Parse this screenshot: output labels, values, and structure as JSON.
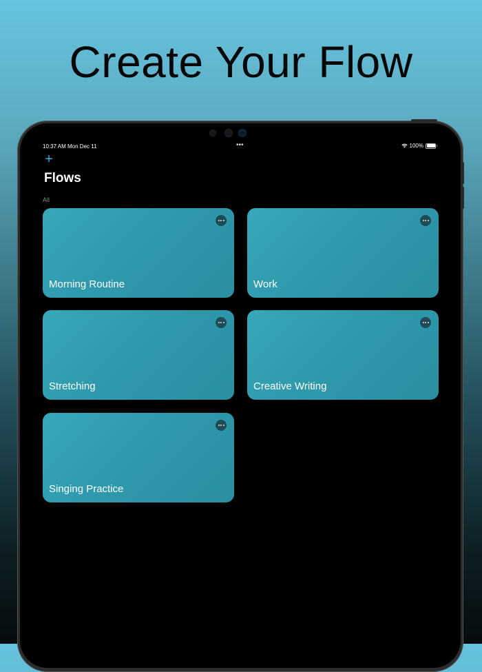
{
  "headline": "Create Your Flow",
  "status_bar": {
    "time": "10:37 AM",
    "date": "Mon Dec 11",
    "dots": "•••",
    "battery_text": "100%"
  },
  "nav": {
    "add_icon": "plus-icon",
    "add_symbol": "+",
    "title": "Flows"
  },
  "section": {
    "label": "All"
  },
  "flows": [
    {
      "title": "Morning Routine"
    },
    {
      "title": "Work"
    },
    {
      "title": "Stretching"
    },
    {
      "title": "Creative Writing"
    },
    {
      "title": "Singing Practice"
    }
  ],
  "colors": {
    "accent": "#35a9e0",
    "card": "#2f9aad",
    "background": "#000000"
  }
}
